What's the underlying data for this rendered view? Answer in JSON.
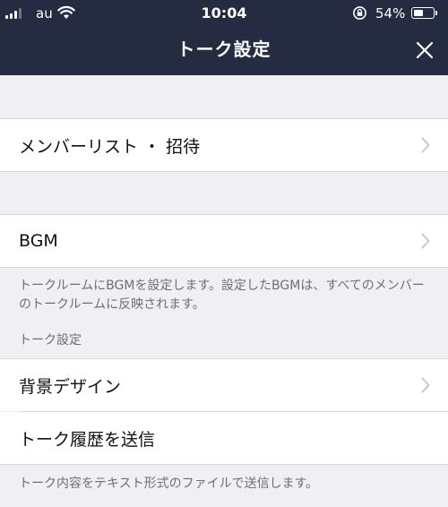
{
  "status_bar": {
    "carrier": "au",
    "time": "10:04",
    "battery_percent": "54%",
    "battery_level": 0.54
  },
  "nav": {
    "title": "トーク設定",
    "close_icon": "close-icon"
  },
  "rows": {
    "members": "メンバーリスト ・ 招待",
    "bgm": "BGM",
    "background": "背景デザイン",
    "send_history": "トーク履歴を送信"
  },
  "notes": {
    "bgm": "トークルームにBGMを設定します。設定したBGMは、すべてのメンバーのトークルームに反映されます。",
    "send_history": "トーク内容をテキスト形式のファイルで送信します。"
  },
  "sections": {
    "talk_settings": "トーク設定"
  },
  "colors": {
    "header_bg": "#252c41",
    "page_bg": "#efeff4"
  }
}
